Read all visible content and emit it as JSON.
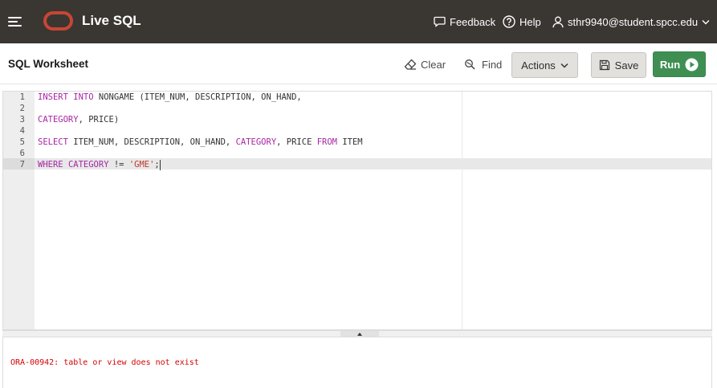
{
  "header": {
    "app_title": "Live SQL",
    "feedback_label": "Feedback",
    "help_label": "Help",
    "user_email": "sthr9940@student.spcc.edu",
    "bg_color": "#3a3632",
    "brand_color": "#c74634",
    "icons": [
      "hamburger-menu-icon",
      "oracle-logo",
      "feedback-icon",
      "help-icon",
      "user-icon",
      "chevron-down-icon"
    ]
  },
  "toolbar": {
    "title": "SQL Worksheet",
    "clear_label": "Clear",
    "find_label": "Find",
    "actions_label": "Actions",
    "save_label": "Save",
    "run_label": "Run",
    "run_color": "#3f8f53"
  },
  "editor": {
    "active_line": 7,
    "lines": [
      {
        "number": "1",
        "text": "INSERT INTO NONGAME (ITEM_NUM, DESCRIPTION, ON_HAND,"
      },
      {
        "number": "2",
        "text": ""
      },
      {
        "number": "3",
        "text": "CATEGORY, PRICE)"
      },
      {
        "number": "4",
        "text": ""
      },
      {
        "number": "5",
        "text": "SELECT ITEM_NUM, DESCRIPTION, ON_HAND, CATEGORY, PRICE FROM ITEM"
      },
      {
        "number": "6",
        "text": ""
      },
      {
        "number": "7",
        "text": "WHERE CATEGORY != 'GME';"
      }
    ],
    "keyword_color": "#a626a4",
    "string_color": "#c0392b"
  },
  "output": {
    "error_text": "ORA-00942: table or view does not exist",
    "error_color": "#d40000"
  }
}
